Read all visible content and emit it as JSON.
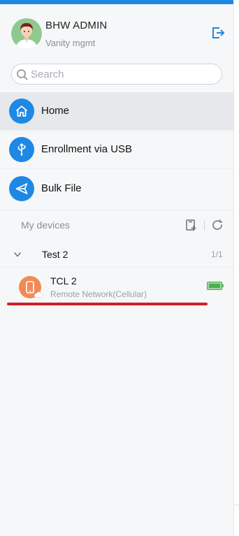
{
  "user": {
    "name": "BHW ADMIN",
    "org": "Vanity mgmt"
  },
  "search": {
    "placeholder": "Search",
    "value": ""
  },
  "nav": {
    "items": [
      {
        "label": "Home",
        "icon": "home-icon",
        "active": true
      },
      {
        "label": "Enrollment via USB",
        "icon": "usb-icon",
        "active": false
      },
      {
        "label": "Bulk File",
        "icon": "send-icon",
        "active": false
      }
    ]
  },
  "devices": {
    "section_title": "My devices",
    "groups": [
      {
        "name": "Test 2",
        "count": "1/1",
        "expanded": true,
        "devices": [
          {
            "name": "TCL 2",
            "status": "Remote Network(Cellular)",
            "icon": "phone-icon",
            "battery_icon": "battery-icon"
          }
        ]
      }
    ]
  },
  "colors": {
    "accent": "#1e88e5",
    "device_icon": "#f08a56",
    "battery": "#4caf50",
    "highlight": "#d21f26"
  }
}
